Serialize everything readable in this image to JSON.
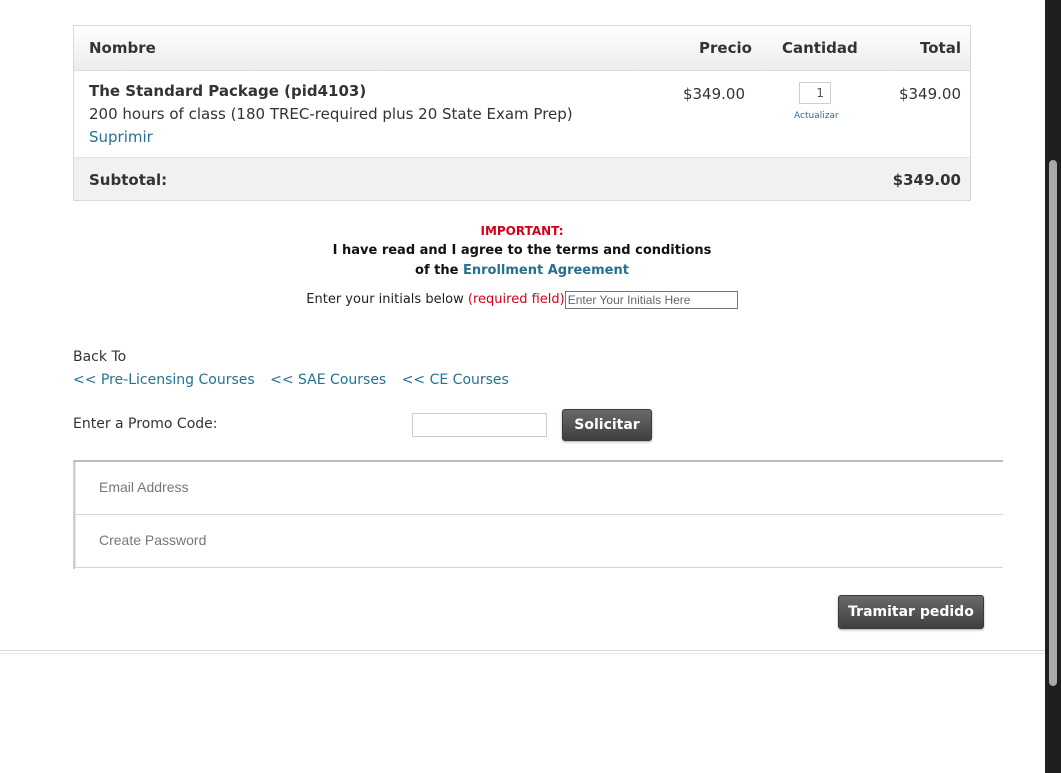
{
  "cart": {
    "headers": {
      "name": "Nombre",
      "price": "Precio",
      "quantity": "Cantidad",
      "total": "Total"
    },
    "items": [
      {
        "title": "The Standard Package (pid4103)",
        "description": "200 hours of class (180 TREC-required plus 20 State Exam Prep)",
        "remove_label": "Suprimir",
        "price": "$349.00",
        "quantity": "1",
        "update_label": "Actualizar",
        "total": "$349.00"
      }
    ],
    "subtotal_label": "Subtotal:",
    "subtotal_value": "$349.00"
  },
  "agreement": {
    "important": "IMPORTANT:",
    "line1": "I have read and I agree to the terms and conditions",
    "line2_prefix": "of the",
    "link": "Enrollment Agreement",
    "initials_label": "Enter your initials below",
    "required_label": "(required field)",
    "initials_placeholder": "Enter Your Initials Here"
  },
  "back_to": {
    "label": "Back To",
    "links": [
      "<< Pre-Licensing Courses",
      "<< SAE Courses",
      "<< CE Courses"
    ]
  },
  "promo": {
    "label": "Enter a Promo Code:",
    "value": "",
    "apply_label": "Solicitar"
  },
  "account": {
    "email_placeholder": "Email Address",
    "password_placeholder": "Create Password"
  },
  "checkout_label": "Tramitar pedido",
  "colors": {
    "link": "#24728f",
    "important": "#d0021b",
    "button": "#4f4f4f"
  }
}
